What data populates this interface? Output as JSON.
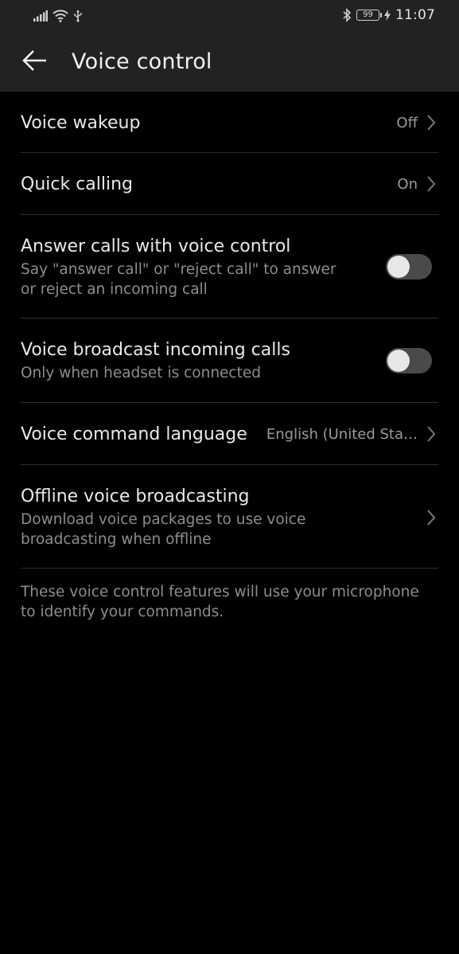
{
  "status_bar": {
    "battery_level": "99",
    "time": "11:07"
  },
  "header": {
    "title": "Voice control"
  },
  "settings": {
    "voice_wakeup": {
      "label": "Voice wakeup",
      "value": "Off"
    },
    "quick_calling": {
      "label": "Quick calling",
      "value": "On"
    },
    "answer_calls": {
      "label": "Answer calls with voice control",
      "description": "Say \"answer call\" or \"reject call\" to answer or reject an incoming call",
      "enabled": false
    },
    "voice_broadcast": {
      "label": "Voice broadcast incoming calls",
      "description": "Only when headset is connected",
      "enabled": false
    },
    "command_language": {
      "label": "Voice command language",
      "value": "English (United Sta…"
    },
    "offline_broadcasting": {
      "label": "Offline voice broadcasting",
      "description": "Download voice packages to use voice broadcasting when offline"
    }
  },
  "footer_note": "These voice control features will use your microphone to identify your commands.",
  "colors": {
    "background": "#000000",
    "app_bar": "#222222",
    "toggle_off_track": "#4a4a4a",
    "toggle_knob": "#e7e7e7"
  }
}
